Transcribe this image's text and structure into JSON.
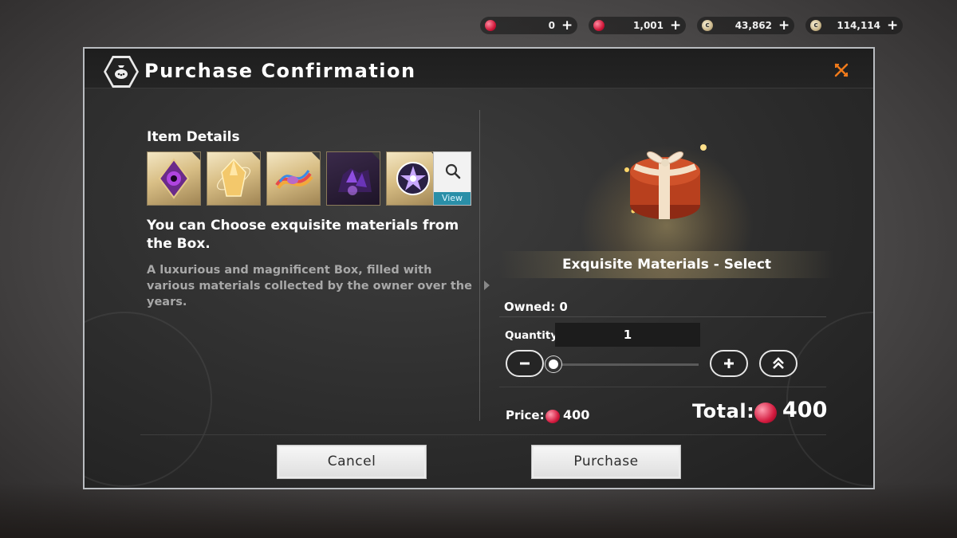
{
  "currencies": [
    {
      "icon": "ruby-icon",
      "value": "0"
    },
    {
      "icon": "ruby-icon",
      "value": "1,001"
    },
    {
      "icon": "coin-icon",
      "value": "43,862"
    },
    {
      "icon": "coin-icon",
      "value": "114,114"
    }
  ],
  "dialog": {
    "title": "Purchase Confirmation",
    "close_icon": "close-icon",
    "item_details_title": "Item Details",
    "items": [
      {
        "name": "purple-gem-icon"
      },
      {
        "name": "amber-crystal-icon"
      },
      {
        "name": "rainbow-thread-icon"
      },
      {
        "name": "dark-ore-icon"
      },
      {
        "name": "star-orb-icon"
      }
    ],
    "view_label": "View",
    "description_main": "You can Choose exquisite materials from the Box.",
    "description_sub": "A luxurious and magnificent Box, filled with various materials collected by the owner over the years.",
    "product_name": "Exquisite Materials - Select",
    "owned_text": "Owned: 0",
    "quantity_label": "Quantity",
    "quantity_value": "1",
    "price_label": "Price:",
    "price_value": "400",
    "total_label": "Total:",
    "total_value": "400",
    "cancel_label": "Cancel",
    "purchase_label": "Purchase"
  },
  "colors": {
    "accent_close": "#f07a1a",
    "view_bar": "#2a8fa8",
    "gem": "#d41c40"
  }
}
